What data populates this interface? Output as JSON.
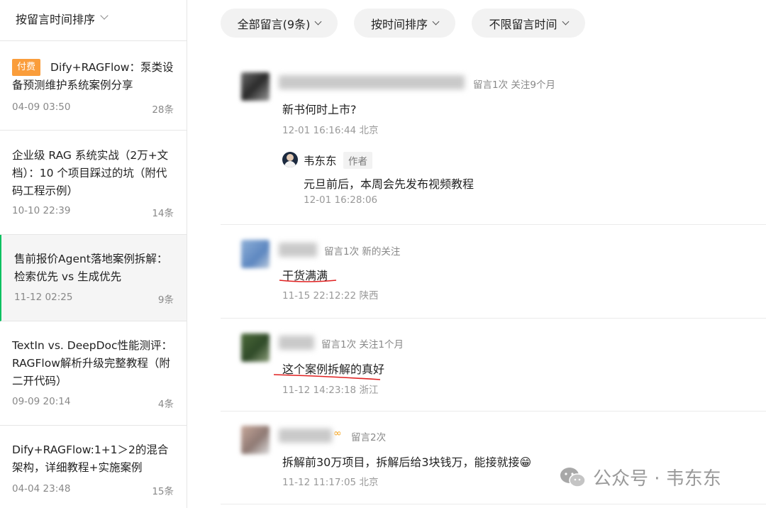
{
  "sidebar": {
    "sort_label": "按留言时间排序",
    "articles": [
      {
        "badge": "付费",
        "title": "Dify+RAGFlow：泵类设备预测维护系统案例分享",
        "date": "04-09 03:50",
        "count": "28条"
      },
      {
        "title": "企业级 RAG 系统实战（2万+文档）：10 个项目踩过的坑（附代码工程示例）",
        "date": "10-10 22:39",
        "count": "14条"
      },
      {
        "title": "售前报价Agent落地案例拆解：检索优先 vs 生成优先",
        "date": "11-12 02:25",
        "count": "9条"
      },
      {
        "title": "TextIn vs. DeepDoc性能测评：RAGFlow解析升级完整教程（附二开代码）",
        "date": "09-09 20:14",
        "count": "4条"
      },
      {
        "title": "Dify+RAGFlow:1+1＞2的混合架构，详细教程+实施案例",
        "date": "04-04 23:48",
        "count": "15条"
      }
    ]
  },
  "filters": {
    "all": "全部留言(9条)",
    "sort": "按时间排序",
    "time": "不限留言时间"
  },
  "comments": [
    {
      "meta": "留言1次 关注9个月",
      "text": "新书何时上市?",
      "time": "12-01 16:16:44 北京",
      "reply": {
        "name": "韦东东",
        "tag": "作者",
        "text": "元旦前后，本周会先发布视频教程",
        "time": "12-01 16:28:06"
      }
    },
    {
      "meta": "留言1次 新的关注",
      "text": "干货满满",
      "time": "11-15 22:12:22 陕西"
    },
    {
      "meta": "留言1次 关注1个月",
      "text": "这个案例拆解的真好",
      "time": "11-12 14:23:18 浙江"
    },
    {
      "meta": "留言2次",
      "text": "拆解前30万项目，拆解后给3块钱万，能接就接😁",
      "time": "11-12 11:17:05 北京"
    }
  ],
  "watermark": {
    "label": "公众号 · 韦东东"
  },
  "colors": {
    "accent_green": "#07c160",
    "badge_orange": "#fa9d3b",
    "underline_red": "#e02020"
  }
}
